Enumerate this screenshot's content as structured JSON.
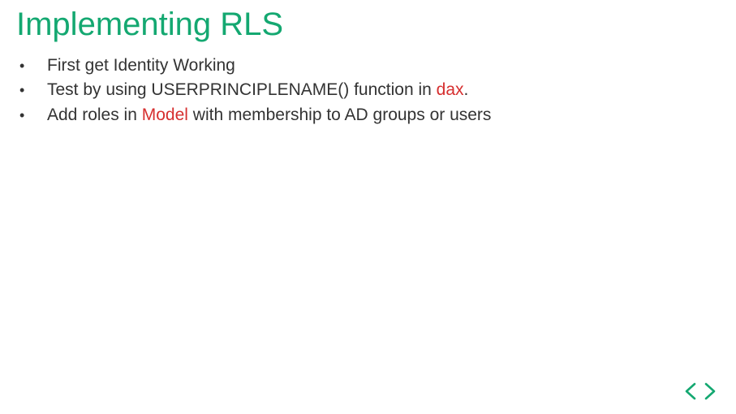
{
  "colors": {
    "accent": "#14a871",
    "highlight": "#d62f2f",
    "body_text": "#333333",
    "background": "#ffffff"
  },
  "title": "Implementing RLS",
  "bullets": [
    {
      "text": "First get Identity Working"
    },
    {
      "prefix": "Test by using USERPRINCIPLENAME()  function in ",
      "highlight": "dax",
      "suffix": "."
    },
    {
      "prefix": "Add roles in ",
      "highlight": "Model",
      "suffix": " with membership to AD groups or users"
    }
  ]
}
